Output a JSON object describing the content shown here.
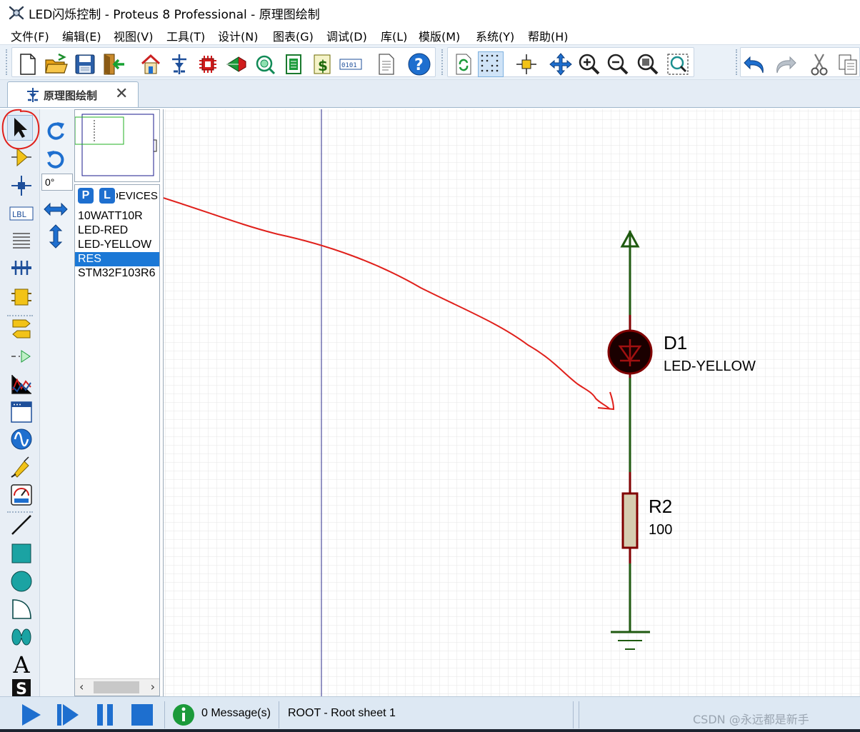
{
  "window": {
    "title": "LED闪烁控制 - Proteus 8 Professional - 原理图绘制"
  },
  "menu": [
    "文件(F)",
    "编辑(E)",
    "视图(V)",
    "工具(T)",
    "设计(N)",
    "图表(G)",
    "调试(D)",
    "库(L)",
    "模版(M)",
    "系统(Y)",
    "帮助(H)"
  ],
  "toolbar": {
    "file_tools": [
      "new-file-icon",
      "open-folder-icon",
      "save-icon",
      "close-project-icon"
    ],
    "app_tools": [
      "home-icon",
      "schematic-icon",
      "pcb-icon",
      "3d-viewer-icon",
      "gerber-icon",
      "design-explorer-icon",
      "bill-of-materials-icon",
      "source-code-icon",
      "notes-icon",
      "help-icon"
    ],
    "view_tools": [
      "refresh-icon",
      "grid-toggle-icon",
      "origin-icon",
      "pan-icon",
      "zoom-in-icon",
      "zoom-out-icon",
      "zoom-all-icon",
      "zoom-area-icon"
    ],
    "edit_tools": [
      "undo-icon",
      "redo-icon",
      "cut-icon",
      "copy-icon"
    ],
    "active_tool": "grid-toggle-icon"
  },
  "tab": {
    "label": "原理图绘制",
    "close": "✕"
  },
  "left_tools": {
    "items": [
      "selection-mode-icon",
      "component-mode-icon",
      "junction-dot-icon",
      "wire-label-icon",
      "text-script-icon",
      "bus-icon",
      "subcircuit-icon",
      "terminal-icon",
      "device-pin-icon",
      "graph-icon",
      "tape-recorder-icon",
      "generator-icon",
      "voltage-probe-icon",
      "virtual-instrument-icon",
      "line-icon",
      "box-icon",
      "circle-icon",
      "arc-icon",
      "closed-path-icon",
      "text-icon",
      "symbol-icon"
    ],
    "labels": {
      "lbl": "LBL",
      "text": "A",
      "symbol": "S"
    }
  },
  "rotation": {
    "angle": "0°"
  },
  "devices": {
    "p_button": "P",
    "l_button": "L",
    "header": "DEVICES",
    "items": [
      "10WATT10R",
      "LED-RED",
      "LED-YELLOW",
      "RES",
      "STM32F103R6"
    ],
    "selected": "RES"
  },
  "schematic": {
    "components": [
      {
        "ref": "D1",
        "value": "LED-YELLOW",
        "type": "led"
      },
      {
        "ref": "R2",
        "value": "100",
        "type": "resistor"
      }
    ],
    "power": "power-terminal",
    "ground": "ground-terminal",
    "colors": {
      "wire": "#1f5a10",
      "component": "#800000",
      "led_body": "#1a0000",
      "annotation": "#e0201b",
      "grid": "#e6e6e6"
    }
  },
  "status": {
    "controls": [
      "play-icon",
      "step-icon",
      "pause-icon",
      "stop-icon"
    ],
    "messages": "0 Message(s)",
    "sheet": "ROOT - Root sheet 1",
    "watermark": "CSDN @永远都是新手"
  }
}
